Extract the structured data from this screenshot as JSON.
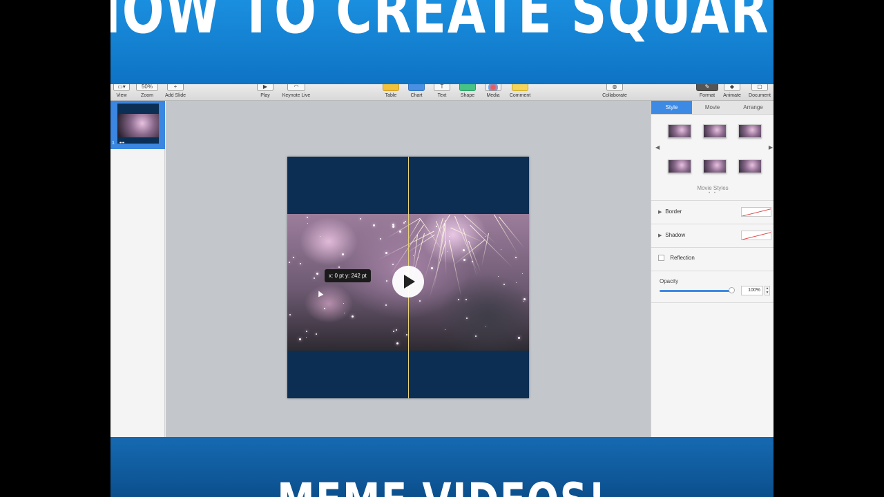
{
  "banner": {
    "top_text": "HOW TO CREATE SQUARE",
    "bottom_text": "MEME VIDEOS!"
  },
  "toolbar": {
    "view": {
      "label": "View",
      "icon": "sidebar-icon"
    },
    "zoom": {
      "label": "Zoom",
      "value": "50%"
    },
    "add_slide": {
      "label": "Add Slide",
      "icon": "plus-icon"
    },
    "play": {
      "label": "Play",
      "icon": "play-icon"
    },
    "keynote_live": {
      "label": "Keynote Live",
      "icon": "live-icon"
    },
    "table": {
      "label": "Table"
    },
    "chart": {
      "label": "Chart"
    },
    "text": {
      "label": "Text",
      "icon": "T"
    },
    "shape": {
      "label": "Shape"
    },
    "media": {
      "label": "Media"
    },
    "comment": {
      "label": "Comment"
    },
    "collaborate": {
      "label": "Collaborate"
    },
    "format": {
      "label": "Format"
    },
    "animate": {
      "label": "Animate"
    },
    "document": {
      "label": "Document"
    }
  },
  "navigator": {
    "slide_number": "1",
    "slide_dots": "•••"
  },
  "canvas": {
    "tooltip": "x: 0 pt  y: 242 pt"
  },
  "inspector": {
    "tabs": [
      {
        "label": "Style",
        "active": true
      },
      {
        "label": "Movie",
        "active": false
      },
      {
        "label": "Arrange",
        "active": false
      }
    ],
    "styles_label": "Movie Styles",
    "styles_dots": "• •",
    "border_label": "Border",
    "shadow_label": "Shadow",
    "reflection_label": "Reflection",
    "opacity_label": "Opacity",
    "opacity_value": "100%",
    "opacity_fraction": 1.0
  },
  "colors": {
    "accent": "#3d8ae5",
    "slide_background": "#0d2e53",
    "banner_top": "#1b8fdf",
    "banner_bottom": "#0b4f8d"
  }
}
